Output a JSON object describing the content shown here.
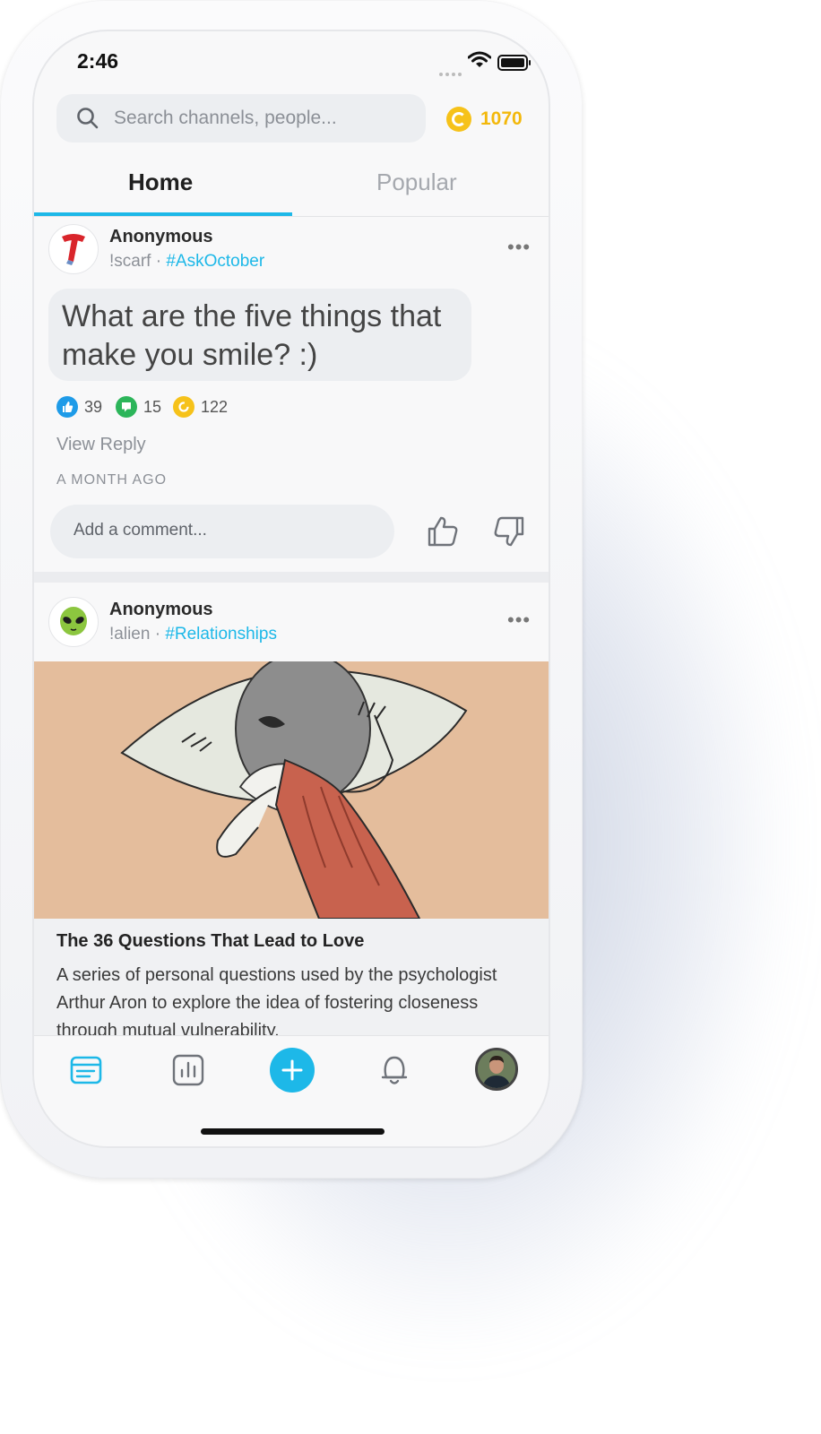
{
  "status_bar": {
    "time": "2:46"
  },
  "search": {
    "placeholder": "Search channels, people..."
  },
  "coins": {
    "count": "1070"
  },
  "tabs": [
    {
      "label": "Home"
    },
    {
      "label": "Popular"
    }
  ],
  "posts": [
    {
      "user": "Anonymous",
      "handle": "!scarf",
      "separator": " · ",
      "tag": "#AskOctober",
      "text": "What are the five things that make you smile? :)",
      "likes": "39",
      "comments": "15",
      "coins": "122",
      "view_reply": "View Reply",
      "time_ago": "A MONTH AGO",
      "comment_placeholder": "Add a comment..."
    },
    {
      "user": "Anonymous",
      "handle": "!alien",
      "separator": " · ",
      "tag": "#Relationships",
      "article_title": "The 36 Questions That Lead to Love",
      "article_description": "A series of personal questions used by the psychologist Arthur Aron to explore the idea of fostering closeness through mutual vulnerability."
    }
  ],
  "more_glyph": "•••",
  "colors": {
    "accent": "#1db8e8",
    "coin": "#f6c21a",
    "like": "#1e9be8",
    "comment": "#2cb55a"
  },
  "icons": {
    "avatar1": "scarf-icon",
    "avatar2": "alien-icon",
    "tabbar": [
      "feed-icon",
      "stats-icon",
      "plus-icon",
      "bell-icon",
      "profile-avatar"
    ]
  }
}
